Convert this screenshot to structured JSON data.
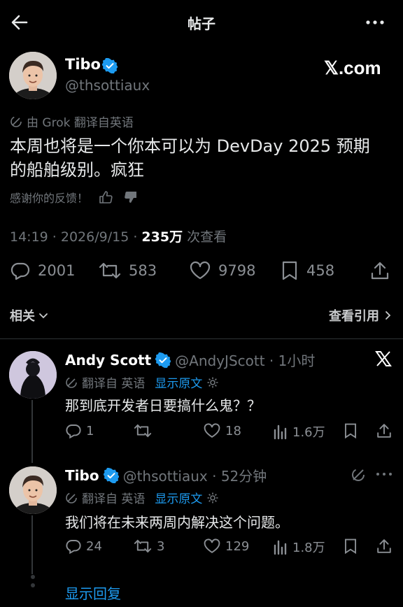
{
  "header": {
    "title": "帖子"
  },
  "post": {
    "author_name": "Tibo",
    "author_handle": "@thsottiaux",
    "brand": "𝕏.com",
    "translation_note": "由 Grok 翻译自英语",
    "text_line1": "本周也将是一个你本可以为 DevDay 2025 预期",
    "text_line2": "的船舶级别。疯狂",
    "feedback_label": "感谢你的反馈！",
    "time": "14:19 · 2026/9/15 · ",
    "views": "235万",
    "views_label": " 次查看",
    "stats": {
      "replies": "2001",
      "reposts": "583",
      "likes": "9798",
      "bookmarks": "458"
    }
  },
  "nav": {
    "related": "相关",
    "quotes": "查看引用"
  },
  "replies": [
    {
      "name": "Andy Scott",
      "handle": "@AndyJScott · 1小时",
      "translated": "翻译自 英语",
      "show_original": "显示原文",
      "text": "那到底开发者日要搞什么鬼？？",
      "stats": {
        "replies": "1",
        "reposts": "",
        "likes": "18",
        "views": "1.6万"
      }
    },
    {
      "name": "Tibo",
      "handle": "@thsottiaux · 52分钟",
      "translated": "翻译自 英语",
      "show_original": "显示原文",
      "text": "我们将在未来两周内解决这个问题。",
      "stats": {
        "replies": "24",
        "reposts": "3",
        "likes": "129",
        "views": "1.8万"
      }
    }
  ],
  "show_replies": "显示回复",
  "colors": {
    "background": "#000000",
    "accent": "#1d9bf0",
    "muted": "#71767b",
    "text": "#e7e9ea"
  },
  "icons": [
    "back-arrow-icon",
    "more-icon",
    "verified-badge-icon",
    "translate-icon",
    "thumbs-up-icon",
    "thumbs-down-icon",
    "reply-icon",
    "repost-icon",
    "like-icon",
    "bookmark-icon",
    "share-icon",
    "chevron-down-icon",
    "chevron-right-icon",
    "x-logo-icon",
    "gear-icon",
    "views-icon",
    "grok-icon"
  ]
}
